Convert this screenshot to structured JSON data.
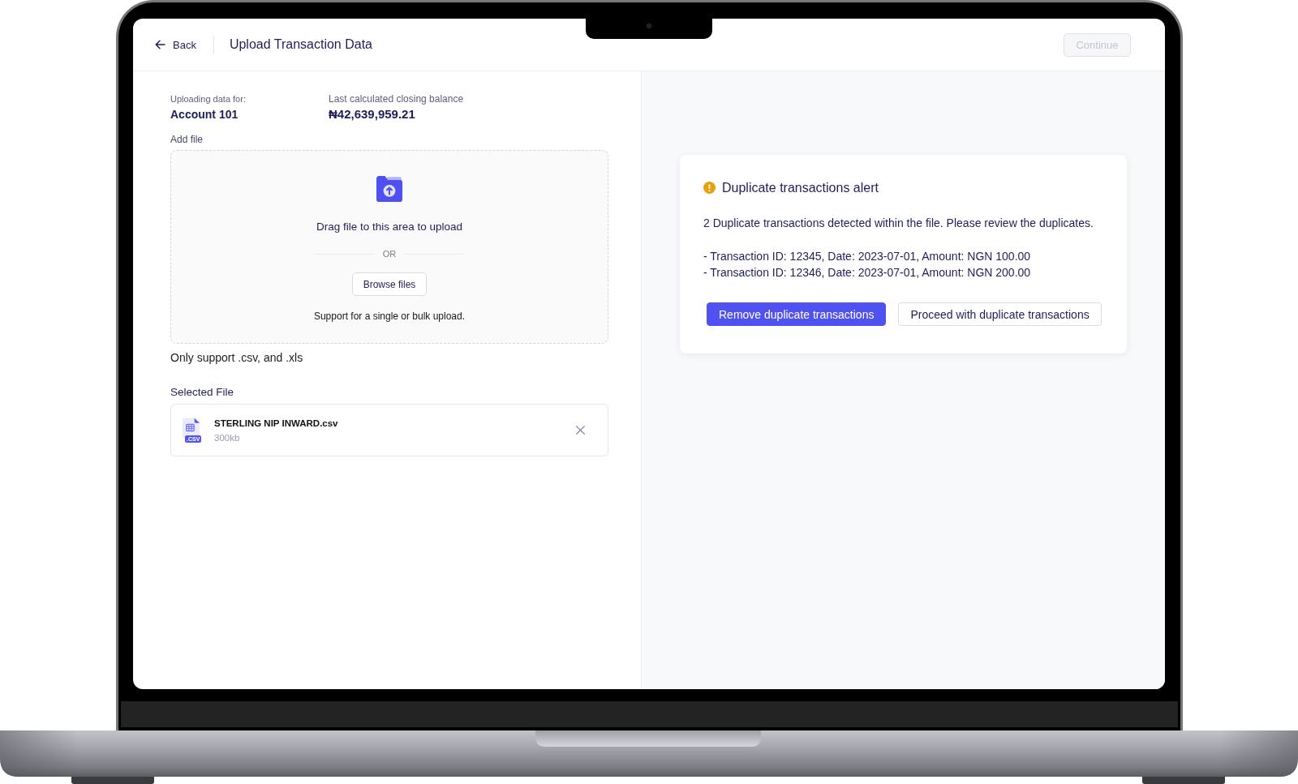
{
  "header": {
    "back_label": "Back",
    "title": "Upload Transaction Data",
    "continue_button": {
      "label": "Continue",
      "disabled": true
    }
  },
  "upload_panel": {
    "account": {
      "label": "Uploading data for:",
      "value": "Account 101"
    },
    "balance": {
      "label": "Last calculated closing balance",
      "value": "₦42,639,959.21"
    },
    "add_file_label": "Add file",
    "dropzone": {
      "instruction": "Drag file to this area to upload",
      "separator": "OR",
      "browse_button": "Browse files",
      "note": "Support for a single or bulk upload."
    },
    "format_note": "Only support .csv, and .xls",
    "selected_file": {
      "heading": "Selected File",
      "name": "STERLING NIP INWARD.csv",
      "size": "300kb",
      "type_badge": ".CSV"
    }
  },
  "alert": {
    "title": "Duplicate transactions alert",
    "message": "2 Duplicate transactions detected within the file. Please review the duplicates.",
    "duplicates": [
      "- Transaction ID: 12345, Date: 2023-07-01, Amount: NGN 100.00",
      "- Transaction ID: 12346, Date: 2023-07-01, Amount: NGN 200.00"
    ],
    "buttons": [
      {
        "label": "Remove duplicate transactions",
        "kind": "primary"
      },
      {
        "label": "Proceed with duplicate transactions",
        "kind": "secondary"
      }
    ]
  }
}
